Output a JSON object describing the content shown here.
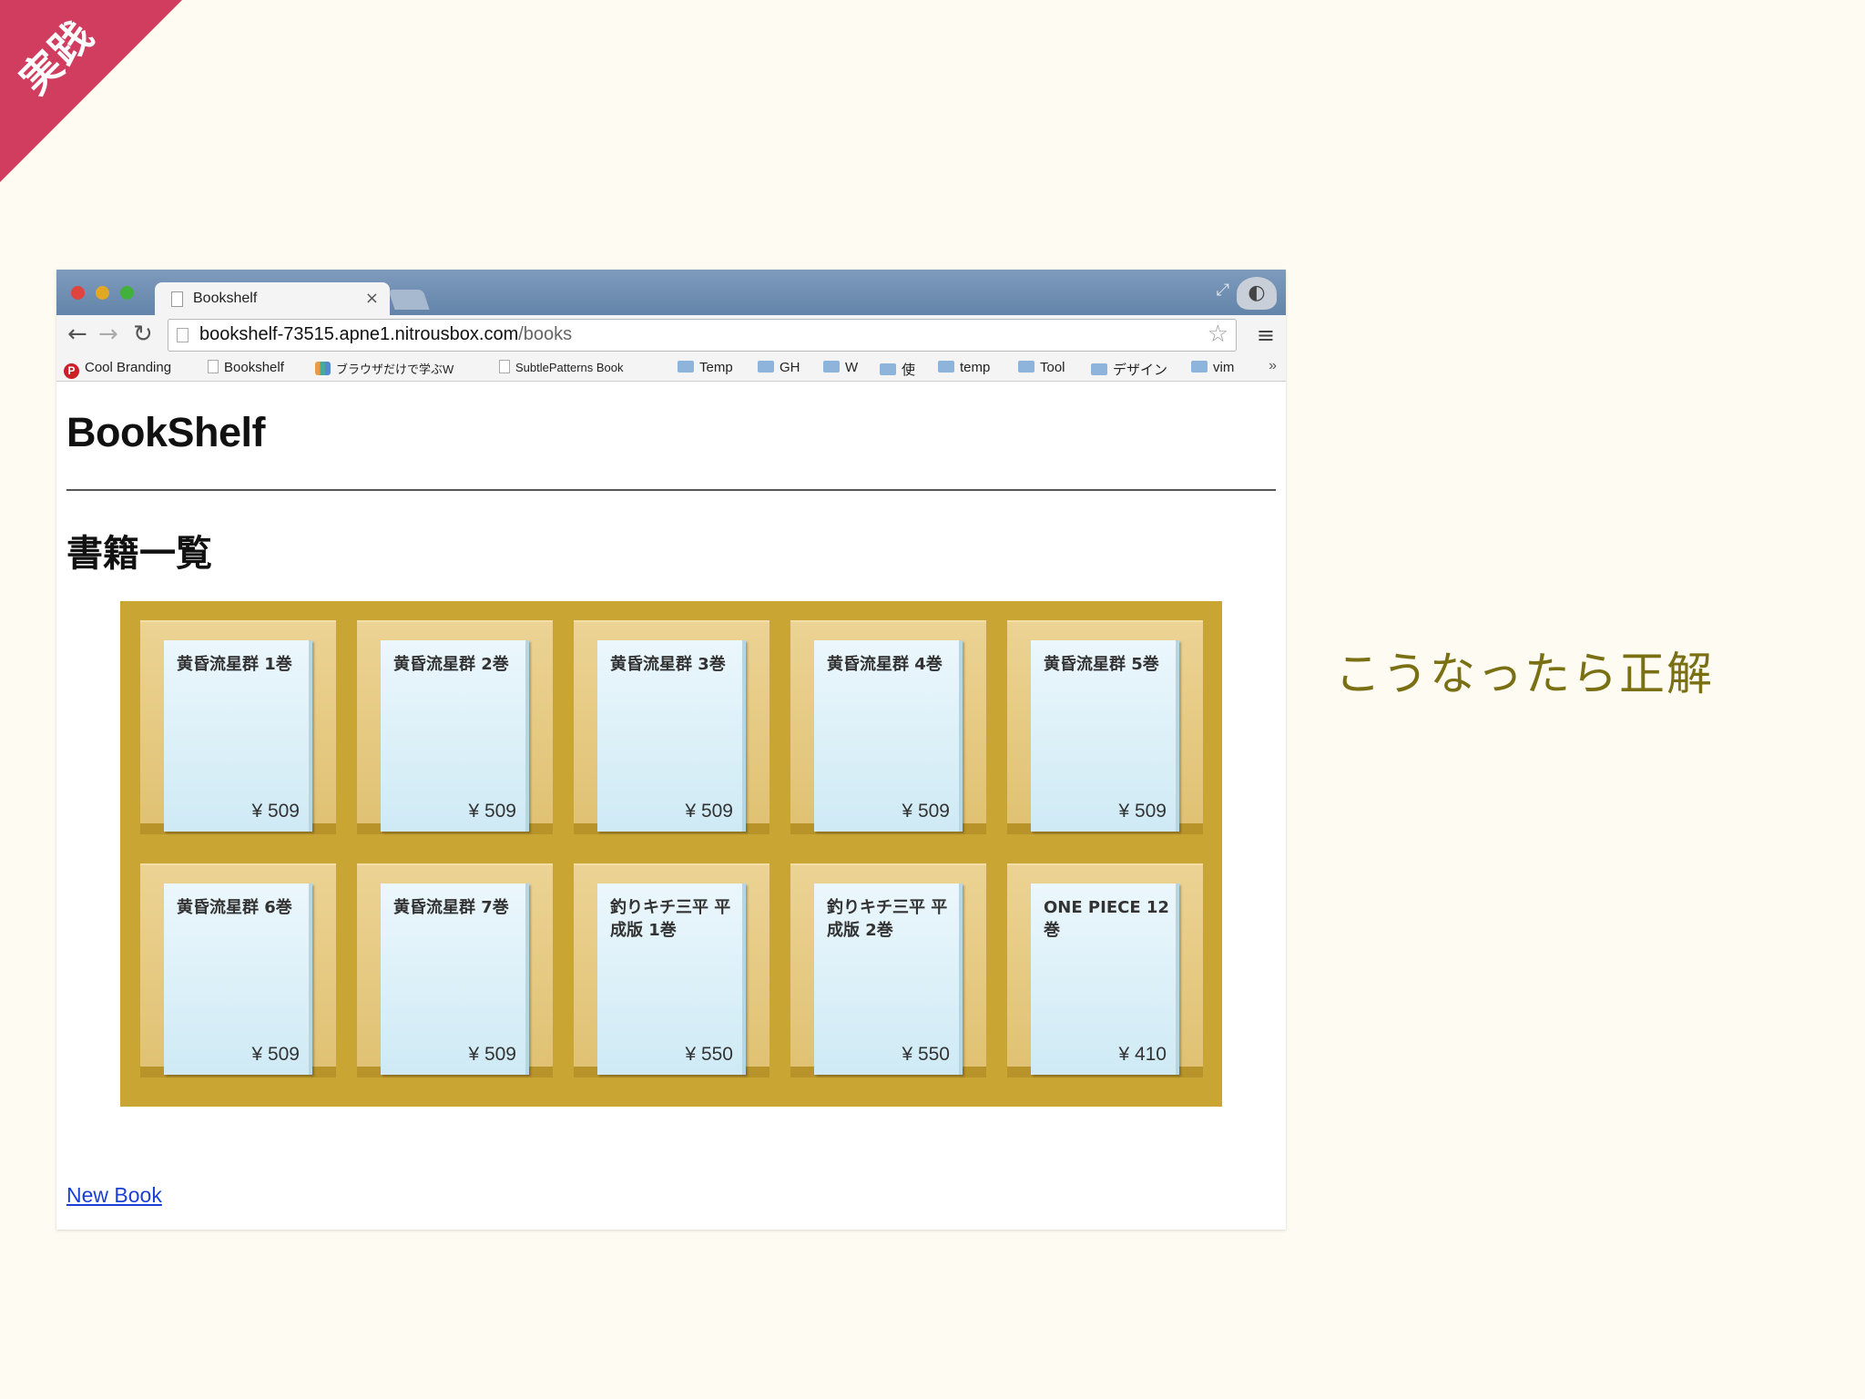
{
  "ribbon": {
    "text": "実践",
    "color": "#d13d5f"
  },
  "caption": "こうなったら正解",
  "browser": {
    "tab_title": "Bookshelf",
    "tab_close": "×",
    "url_host": "bookshelf-73515.apne1.nitrousbox.com",
    "url_path": "/books",
    "bookmarks": [
      {
        "label": "Cool Branding",
        "icon": "pinterest-icon"
      },
      {
        "label": "Bookshelf",
        "icon": "page-icon"
      },
      {
        "label": "ブラウザだけで学ぶW",
        "icon": "multicolor-icon"
      },
      {
        "label": "SubtlePatterns Book",
        "icon": "page-icon"
      },
      {
        "label": "Temp",
        "icon": "folder-icon"
      },
      {
        "label": "GH",
        "icon": "folder-icon"
      },
      {
        "label": "W",
        "icon": "folder-icon"
      },
      {
        "label": "使",
        "icon": "folder-icon"
      },
      {
        "label": "temp",
        "icon": "folder-icon"
      },
      {
        "label": "Tool",
        "icon": "folder-icon"
      },
      {
        "label": "デザイン",
        "icon": "folder-icon"
      },
      {
        "label": "vim",
        "icon": "folder-icon"
      }
    ],
    "bookmarks_more": "»"
  },
  "page": {
    "site_title": "BookShelf",
    "list_heading": "書籍一覧",
    "new_book_link": "New Book",
    "books": [
      {
        "title": "黄昏流星群 1巻",
        "price": "¥ 509"
      },
      {
        "title": "黄昏流星群 2巻",
        "price": "¥ 509"
      },
      {
        "title": "黄昏流星群 3巻",
        "price": "¥ 509"
      },
      {
        "title": "黄昏流星群 4巻",
        "price": "¥ 509"
      },
      {
        "title": "黄昏流星群 5巻",
        "price": "¥ 509"
      },
      {
        "title": "黄昏流星群 6巻",
        "price": "¥ 509"
      },
      {
        "title": "黄昏流星群 7巻",
        "price": "¥ 509"
      },
      {
        "title": "釣りキチ三平 平成版 1巻",
        "price": "¥ 550"
      },
      {
        "title": "釣りキチ三平 平成版 2巻",
        "price": "¥ 550"
      },
      {
        "title": "ONE PIECE 12巻",
        "price": "¥ 410"
      }
    ]
  },
  "colors": {
    "shelf": "#c9a533",
    "link": "#1a3fd4",
    "caption": "#7a7013"
  }
}
